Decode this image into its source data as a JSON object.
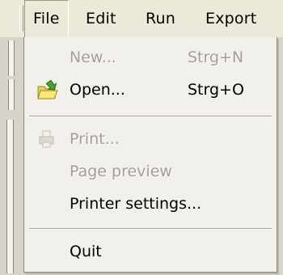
{
  "menubar": {
    "items": [
      {
        "label": "File"
      },
      {
        "label": "Edit"
      },
      {
        "label": "Run"
      },
      {
        "label": "Export"
      }
    ]
  },
  "file_menu": {
    "new": {
      "label": "New...",
      "shortcut": "Strg+N",
      "enabled": false
    },
    "open": {
      "label": "Open...",
      "shortcut": "Strg+O",
      "enabled": true,
      "icon": "open-folder-icon"
    },
    "print": {
      "label": "Print...",
      "enabled": false,
      "icon": "printer-icon"
    },
    "page_preview": {
      "label": "Page preview",
      "enabled": false
    },
    "printer_settings": {
      "label": "Printer settings...",
      "enabled": true
    },
    "quit": {
      "label": "Quit",
      "enabled": true
    }
  }
}
